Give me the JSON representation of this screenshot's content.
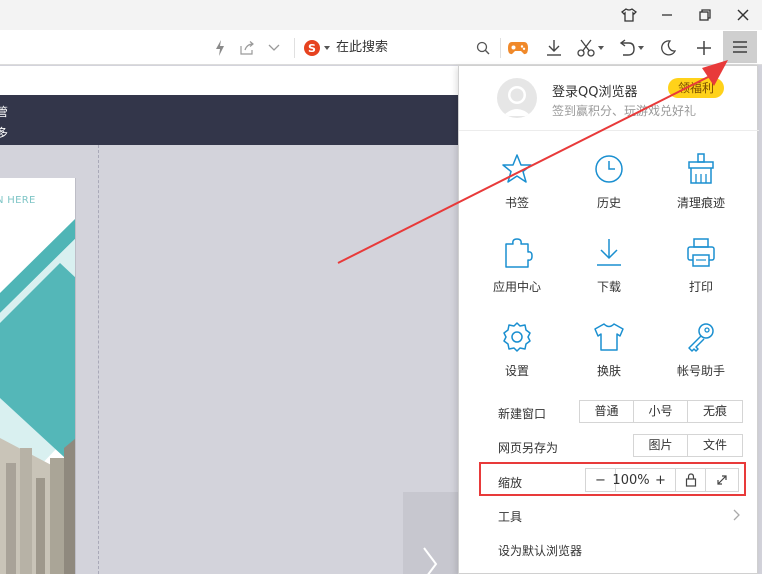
{
  "search": {
    "placeholder": "在此搜索"
  },
  "page": {
    "header_line1": "管",
    "header_line2": "多",
    "doc_text": "N HERE"
  },
  "menu": {
    "login_title": "登录QQ浏览器",
    "badge": "领福利",
    "subtitle": "签到赢积分、玩游戏兑好礼",
    "tiles": [
      {
        "label": "书签",
        "icon": "star-icon"
      },
      {
        "label": "历史",
        "icon": "clock-icon"
      },
      {
        "label": "清理痕迹",
        "icon": "broom-icon"
      },
      {
        "label": "应用中心",
        "icon": "puzzle-icon"
      },
      {
        "label": "下载",
        "icon": "download-icon"
      },
      {
        "label": "打印",
        "icon": "printer-icon"
      },
      {
        "label": "设置",
        "icon": "gear-icon"
      },
      {
        "label": "换肤",
        "icon": "tshirt-icon"
      },
      {
        "label": "帐号助手",
        "icon": "key-icon"
      }
    ],
    "new_window": {
      "label": "新建窗口",
      "options": [
        "普通",
        "小号",
        "无痕"
      ]
    },
    "save_as": {
      "label": "网页另存为",
      "options": [
        "图片",
        "文件"
      ]
    },
    "zoom": {
      "label": "缩放",
      "value": "100%",
      "minus": "−",
      "plus": "+"
    },
    "tools": {
      "label": "工具"
    },
    "default_browser": {
      "label": "设为默认浏览器"
    }
  },
  "colors": {
    "accent_blue": "#1a8fd0",
    "badge_yellow": "#ffd21a",
    "annotation_red": "#e83a3a",
    "page_header": "#33364a"
  }
}
